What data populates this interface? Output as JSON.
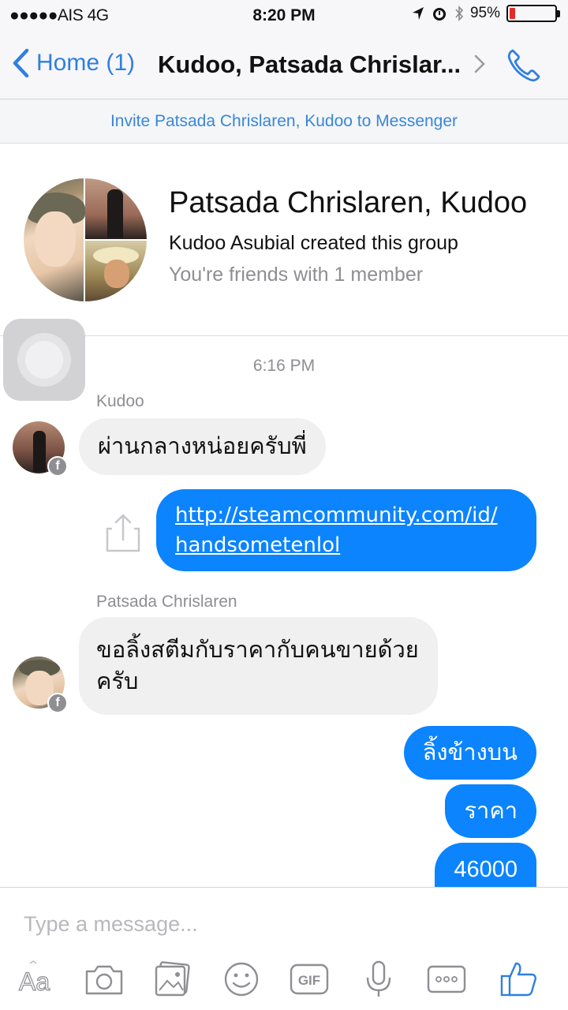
{
  "status_bar": {
    "carrier": "●●●●●AIS 4G",
    "time": "8:20 PM",
    "battery_text": "95%",
    "battery_level": 0.12
  },
  "nav": {
    "back_label": "Home (1)",
    "title": "Kudoo, Patsada Chrislar..."
  },
  "invite_banner": "Invite Patsada Chrislaren, Kudoo to Messenger",
  "group": {
    "name": "Patsada Chrislaren, Kudoo",
    "created": "Kudoo Asubial created this group",
    "friends": "You're friends with 1 member"
  },
  "conversation": {
    "timestamp": "6:16 PM",
    "sender_1": "Kudoo",
    "msg_1": "ผ่านกลางหน่อยครับพี่",
    "link_line_1": "http://steamcommunity.com/id/",
    "link_line_2": "handsometenlol",
    "sender_2": "Patsada Chrislaren",
    "msg_2_line_1": "ขอลิ้งสตีมกับราคากับคนขายด้วย",
    "msg_2_line_2": "ครับ",
    "out_1": "ลิ้งข้างบน",
    "out_2": "ราคา",
    "out_3": "46000"
  },
  "composer": {
    "placeholder": "Type a message..."
  },
  "icons": {
    "badge": "f"
  }
}
